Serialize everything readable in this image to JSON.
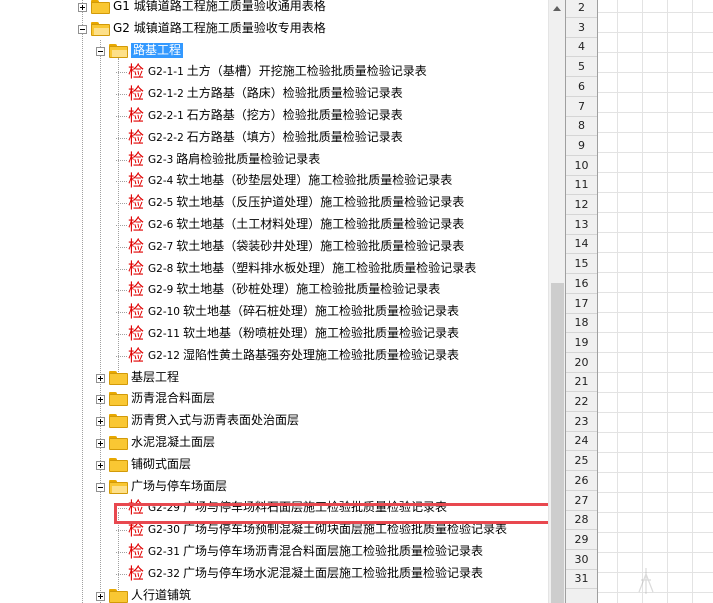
{
  "tree": {
    "g1": {
      "label": "G1 城镇道路工程施工质量验收通用表格"
    },
    "g2": {
      "label": "G2 城镇道路工程施工质量验收专用表格"
    },
    "subgrade": {
      "label": "路基工程",
      "forms": [
        {
          "badge": "检",
          "code": "G2-1-1",
          "title": "土方（基槽）开挖施工检验批质量检验记录表"
        },
        {
          "badge": "检",
          "code": "G2-1-2",
          "title": "土方路基（路床）检验批质量检验记录表"
        },
        {
          "badge": "检",
          "code": "G2-2-1",
          "title": "石方路基（挖方）检验批质量检验记录表"
        },
        {
          "badge": "检",
          "code": "G2-2-2",
          "title": "石方路基（填方）检验批质量检验记录表"
        },
        {
          "badge": "检",
          "code": "G2-3",
          "title": "路肩检验批质量检验记录表"
        },
        {
          "badge": "检",
          "code": "G2-4",
          "title": "软土地基（砂垫层处理）施工检验批质量检验记录表"
        },
        {
          "badge": "检",
          "code": "G2-5",
          "title": "软土地基（反压护道处理）施工检验批质量检验记录表"
        },
        {
          "badge": "检",
          "code": "G2-6",
          "title": "软土地基（土工材料处理）施工检验批质量检验记录表"
        },
        {
          "badge": "检",
          "code": "G2-7",
          "title": "软土地基（袋装砂井处理）施工检验批质量检验记录表"
        },
        {
          "badge": "检",
          "code": "G2-8",
          "title": "软土地基（塑料排水板处理）施工检验批质量检验记录表"
        },
        {
          "badge": "检",
          "code": "G2-9",
          "title": "软土地基（砂桩处理）施工检验批质量检验记录表"
        },
        {
          "badge": "检",
          "code": "G2-10",
          "title": "软土地基（碎石桩处理）施工检验批质量检验记录表"
        },
        {
          "badge": "检",
          "code": "G2-11",
          "title": "软土地基（粉喷桩处理）施工检验批质量检验记录表"
        },
        {
          "badge": "检",
          "code": "G2-12",
          "title": "湿陷性黄土路基强夯处理施工检验批质量检验记录表"
        }
      ]
    },
    "folders": [
      {
        "label": "基层工程"
      },
      {
        "label": "沥青混合料面层"
      },
      {
        "label": "沥青贯入式与沥青表面处治面层"
      },
      {
        "label": "水泥混凝土面层"
      },
      {
        "label": "铺砌式面层"
      }
    ],
    "plaza": {
      "label": "广场与停车场面层",
      "forms": [
        {
          "badge": "检",
          "code": "G2-29",
          "title": "广场与停车场料石面层施工检验批质量检验记录表"
        },
        {
          "badge": "检",
          "code": "G2-30",
          "title": "广场与停车场预制混凝土砌块面层施工检验批质量检验记录表"
        },
        {
          "badge": "检",
          "code": "G2-31",
          "title": "广场与停车场沥青混合料面层施工检验批质量检验记录表"
        },
        {
          "badge": "检",
          "code": "G2-32",
          "title": "广场与停车场水泥混凝土面层施工检验批质量检验记录表"
        }
      ]
    },
    "last": {
      "label": "人行道铺筑"
    }
  },
  "row_headers": [
    "2",
    "3",
    "4",
    "5",
    "6",
    "7",
    "8",
    "9",
    "10",
    "11",
    "12",
    "13",
    "14",
    "15",
    "16",
    "17",
    "18",
    "19",
    "20",
    "21",
    "22",
    "23",
    "24",
    "25",
    "26",
    "27",
    "28",
    "29",
    "30",
    "31"
  ],
  "colors": {
    "selection": "#3399ff",
    "badge_red": "#e00000",
    "highlight_box": "#e8484f",
    "folder": "#f9c733"
  },
  "scrollbar": {
    "position_fraction": 0.47
  }
}
